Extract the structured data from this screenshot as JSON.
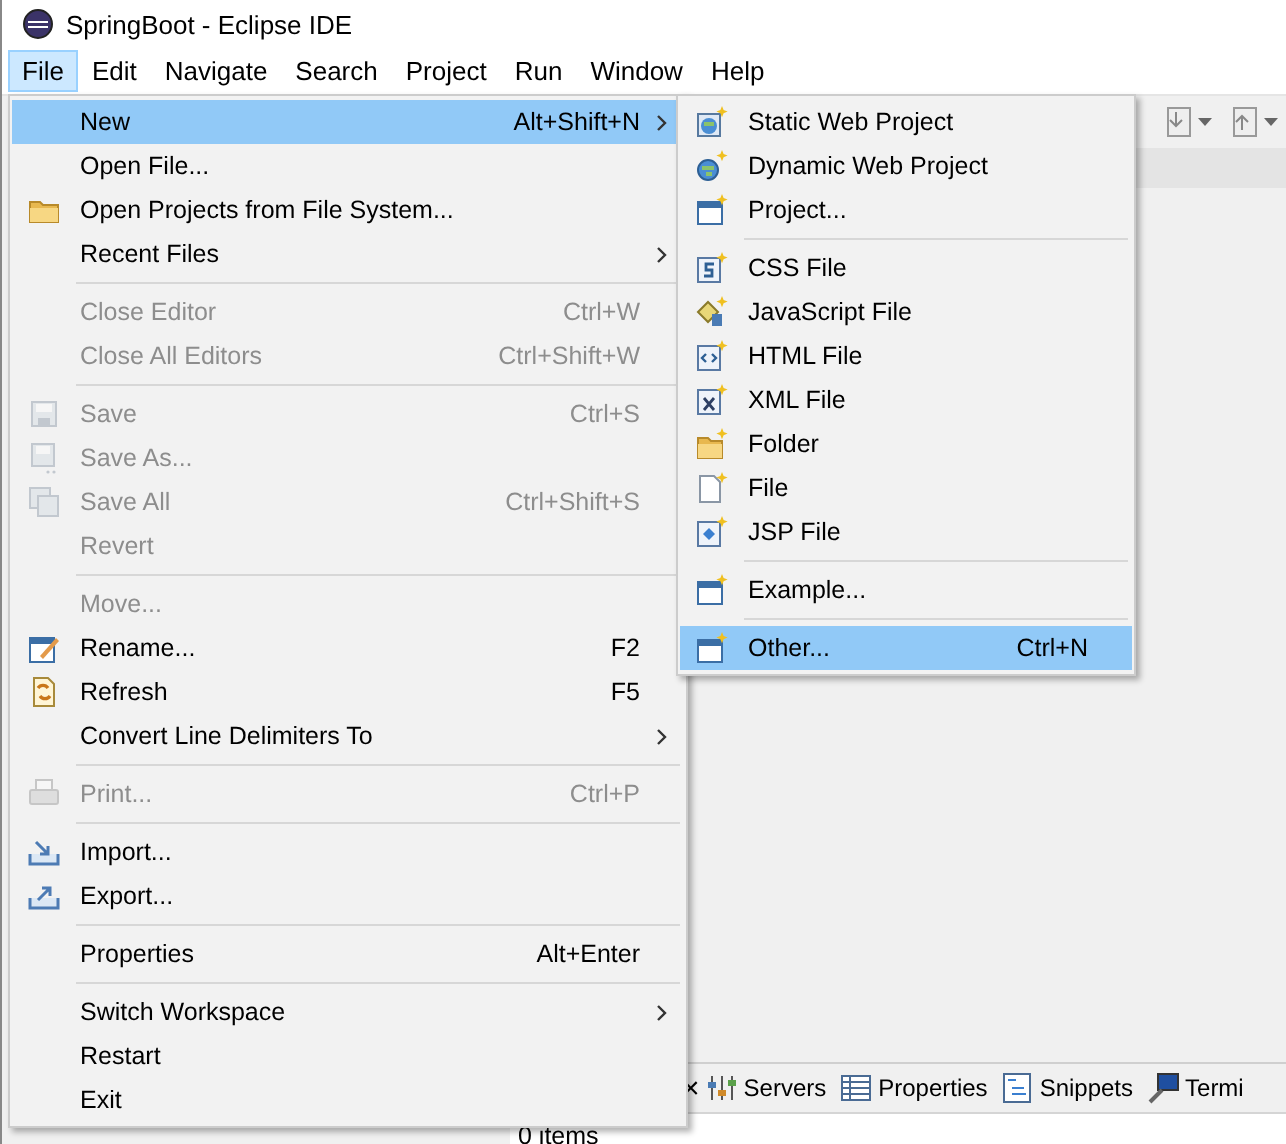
{
  "window": {
    "title": "SpringBoot - Eclipse IDE"
  },
  "menubar": [
    {
      "label": "File",
      "selected": true
    },
    {
      "label": "Edit",
      "selected": false
    },
    {
      "label": "Navigate",
      "selected": false
    },
    {
      "label": "Search",
      "selected": false
    },
    {
      "label": "Project",
      "selected": false
    },
    {
      "label": "Run",
      "selected": false
    },
    {
      "label": "Window",
      "selected": false
    },
    {
      "label": "Help",
      "selected": false
    }
  ],
  "file_menu": [
    {
      "kind": "item",
      "label": "New",
      "shortcut": "Alt+Shift+N",
      "submenu": true,
      "disabled": false,
      "selected": true
    },
    {
      "kind": "item",
      "label": "Open File...",
      "submenu": false,
      "disabled": false,
      "selected": false
    },
    {
      "kind": "item",
      "label": "Open Projects from File System...",
      "submenu": false,
      "disabled": false,
      "selected": false
    },
    {
      "kind": "item",
      "label": "Recent Files",
      "submenu": true,
      "disabled": false,
      "selected": false
    },
    {
      "kind": "separator"
    },
    {
      "kind": "item",
      "label": "Close Editor",
      "shortcut": "Ctrl+W",
      "submenu": false,
      "disabled": true,
      "selected": false
    },
    {
      "kind": "item",
      "label": "Close All Editors",
      "shortcut": "Ctrl+Shift+W",
      "submenu": false,
      "disabled": true,
      "selected": false
    },
    {
      "kind": "separator"
    },
    {
      "kind": "item",
      "label": "Save",
      "shortcut": "Ctrl+S",
      "submenu": false,
      "disabled": true,
      "selected": false
    },
    {
      "kind": "item",
      "label": "Save As...",
      "submenu": false,
      "disabled": true,
      "selected": false
    },
    {
      "kind": "item",
      "label": "Save All",
      "shortcut": "Ctrl+Shift+S",
      "submenu": false,
      "disabled": true,
      "selected": false
    },
    {
      "kind": "item",
      "label": "Revert",
      "submenu": false,
      "disabled": true,
      "selected": false
    },
    {
      "kind": "separator"
    },
    {
      "kind": "item",
      "label": "Move...",
      "submenu": false,
      "disabled": true,
      "selected": false
    },
    {
      "kind": "item",
      "label": "Rename...",
      "shortcut": "F2",
      "submenu": false,
      "disabled": false,
      "selected": false
    },
    {
      "kind": "item",
      "label": "Refresh",
      "shortcut": "F5",
      "submenu": false,
      "disabled": false,
      "selected": false
    },
    {
      "kind": "item",
      "label": "Convert Line Delimiters To",
      "submenu": true,
      "disabled": false,
      "selected": false
    },
    {
      "kind": "separator"
    },
    {
      "kind": "item",
      "label": "Print...",
      "shortcut": "Ctrl+P",
      "submenu": false,
      "disabled": true,
      "selected": false
    },
    {
      "kind": "separator"
    },
    {
      "kind": "item",
      "label": "Import...",
      "submenu": false,
      "disabled": false,
      "selected": false
    },
    {
      "kind": "item",
      "label": "Export...",
      "submenu": false,
      "disabled": false,
      "selected": false
    },
    {
      "kind": "separator"
    },
    {
      "kind": "item",
      "label": "Properties",
      "shortcut": "Alt+Enter",
      "submenu": false,
      "disabled": false,
      "selected": false
    },
    {
      "kind": "separator"
    },
    {
      "kind": "item",
      "label": "Switch Workspace",
      "submenu": true,
      "disabled": false,
      "selected": false
    },
    {
      "kind": "item",
      "label": "Restart",
      "submenu": false,
      "disabled": false,
      "selected": false
    },
    {
      "kind": "item",
      "label": "Exit",
      "submenu": false,
      "disabled": false,
      "selected": false
    }
  ],
  "new_submenu": [
    {
      "kind": "item",
      "label": "Static Web Project",
      "submenu": false,
      "disabled": false,
      "selected": false
    },
    {
      "kind": "item",
      "label": "Dynamic Web Project",
      "submenu": false,
      "disabled": false,
      "selected": false
    },
    {
      "kind": "item",
      "label": "Project...",
      "submenu": false,
      "disabled": false,
      "selected": false
    },
    {
      "kind": "separator"
    },
    {
      "kind": "item",
      "label": "CSS File",
      "submenu": false,
      "disabled": false,
      "selected": false
    },
    {
      "kind": "item",
      "label": "JavaScript File",
      "submenu": false,
      "disabled": false,
      "selected": false
    },
    {
      "kind": "item",
      "label": "HTML File",
      "submenu": false,
      "disabled": false,
      "selected": false
    },
    {
      "kind": "item",
      "label": "XML File",
      "submenu": false,
      "disabled": false,
      "selected": false
    },
    {
      "kind": "item",
      "label": "Folder",
      "submenu": false,
      "disabled": false,
      "selected": false
    },
    {
      "kind": "item",
      "label": "File",
      "submenu": false,
      "disabled": false,
      "selected": false
    },
    {
      "kind": "item",
      "label": "JSP File",
      "submenu": false,
      "disabled": false,
      "selected": false
    },
    {
      "kind": "separator"
    },
    {
      "kind": "item",
      "label": "Example...",
      "submenu": false,
      "disabled": false,
      "selected": false
    },
    {
      "kind": "separator"
    },
    {
      "kind": "item",
      "label": "Other...",
      "shortcut": "Ctrl+N",
      "submenu": false,
      "disabled": false,
      "selected": true
    }
  ],
  "bottom_panel": {
    "close_glyph": "×",
    "tabs": [
      {
        "label": "Servers"
      },
      {
        "label": "Properties"
      },
      {
        "label": "Snippets"
      },
      {
        "label": "Termi"
      }
    ],
    "status": "0 items"
  }
}
